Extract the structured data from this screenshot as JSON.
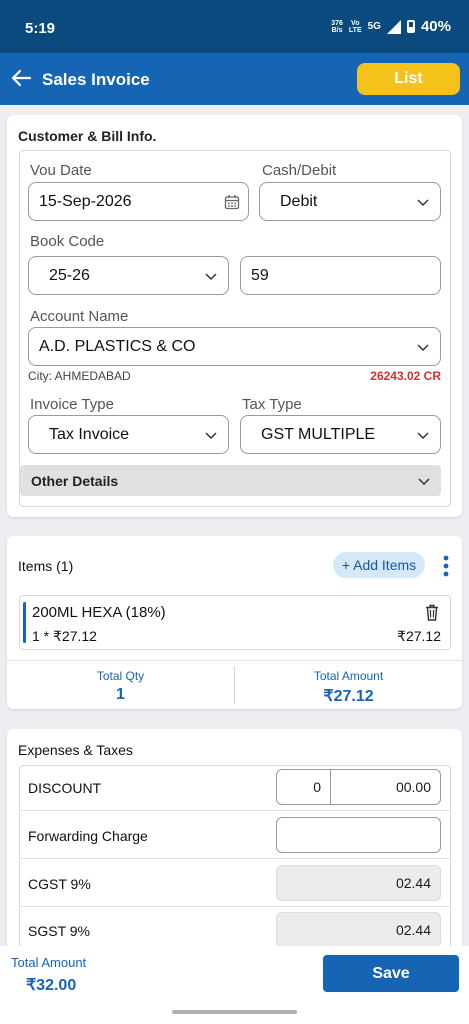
{
  "status_bar": {
    "time": "5:19",
    "net_speed": "376",
    "net_unit": "B/s",
    "volte_top": "Vo",
    "volte_bottom": "LTE",
    "network": "5G",
    "battery": "40%"
  },
  "app_bar": {
    "title": "Sales Invoice",
    "list_label": "List"
  },
  "customer": {
    "section_title": "Customer & Bill Info.",
    "vou_date_label": "Vou Date",
    "vou_date_value": "15-Sep-2026",
    "cash_debit_label": "Cash/Debit",
    "cash_debit_value": "Debit",
    "book_code_label": "Book Code",
    "book_code_value": "25-26",
    "book_number_value": "59",
    "account_name_label": "Account Name",
    "account_name_value": "A.D. PLASTICS & CO",
    "city_text": "City: AHMEDABAD",
    "balance_text": "26243.02 CR",
    "invoice_type_label": "Invoice Type",
    "invoice_type_value": "Tax Invoice",
    "tax_type_label": "Tax Type",
    "tax_type_value": "GST MULTIPLE",
    "other_details_label": "Other Details"
  },
  "items": {
    "section_title": "Items (1)",
    "add_items_label": "+ Add Items",
    "list": [
      {
        "name": "200ML HEXA (18%)",
        "qty_rate": "1 * ₹27.12",
        "amount": "₹27.12"
      }
    ],
    "total_qty_label": "Total Qty",
    "total_qty_value": "1",
    "total_amount_label": "Total Amount",
    "total_amount_value": "₹27.12"
  },
  "expenses": {
    "section_title": "Expenses & Taxes",
    "rows": [
      {
        "label": "DISCOUNT",
        "percent": "0",
        "value": "00.00"
      },
      {
        "label": "Forwarding Charge",
        "value": ""
      },
      {
        "label": "CGST 9%",
        "value": "02.44"
      },
      {
        "label": "SGST 9%",
        "value": "02.44"
      }
    ]
  },
  "bottom": {
    "total_label": "Total Amount",
    "total_value": "₹32.00",
    "save_label": "Save"
  },
  "colors": {
    "status_bar": "#0b4a7f",
    "app_bar": "#1565b4",
    "accent_yellow": "#f5c21b",
    "balance_red": "#d32f2f"
  },
  "icons": [
    "back-arrow-icon",
    "calendar-icon",
    "chevron-down-icon",
    "kebab-menu-icon",
    "trash-icon",
    "signal-icon",
    "battery-icon"
  ]
}
